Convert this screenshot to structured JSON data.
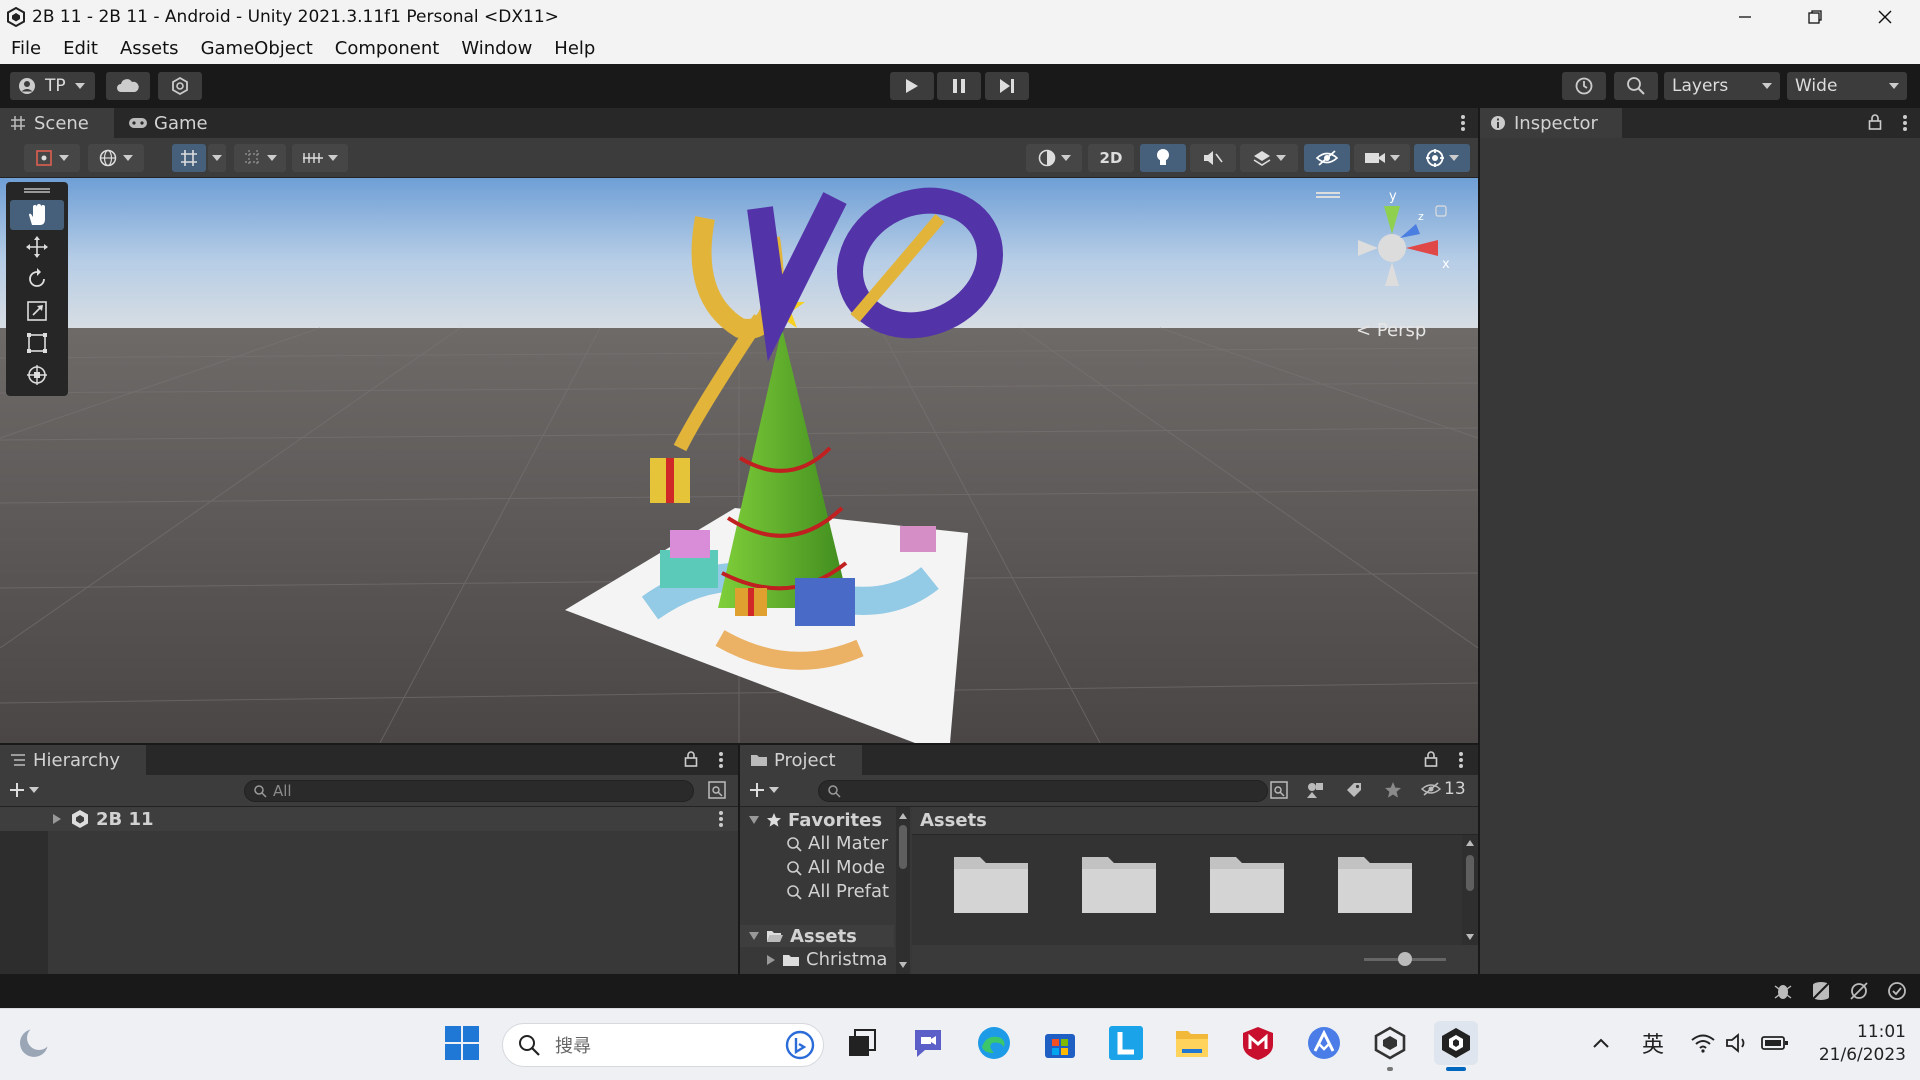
{
  "window": {
    "title": "2B 11 - 2B 11 - Android - Unity 2021.3.11f1 Personal <DX11>"
  },
  "menu": [
    "File",
    "Edit",
    "Assets",
    "GameObject",
    "Component",
    "Window",
    "Help"
  ],
  "toolbar": {
    "account_label": "TP",
    "layers_label": "Layers",
    "layout_label": "Wide"
  },
  "scene_panel": {
    "tabs": [
      "Scene",
      "Game"
    ],
    "toggle_2d": "2D",
    "persp_label": "Persp",
    "gizmo_axes": {
      "y": "y",
      "x": "x",
      "z": "z"
    }
  },
  "inspector": {
    "tab": "Inspector"
  },
  "hierarchy": {
    "tab": "Hierarchy",
    "search_placeholder": "All",
    "root_item": "2B 11"
  },
  "project": {
    "tab": "Project",
    "hidden_count": "13",
    "favorites_label": "Favorites",
    "favorites": [
      "All Mater",
      "All Mode",
      "All Prefat"
    ],
    "assets_label": "Assets",
    "assets_children": [
      "Christma"
    ],
    "breadcrumb": "Assets",
    "folder_count": 4
  },
  "taskbar": {
    "search_placeholder": "搜尋",
    "ime": "英",
    "time": "11:01",
    "date": "21/6/2023"
  },
  "colors": {
    "unity_dark": "#191919",
    "panel": "#383838",
    "tab_active": "#3c3c3c",
    "selected_blue": "#46607c",
    "windows_blue": "#0067c0"
  }
}
